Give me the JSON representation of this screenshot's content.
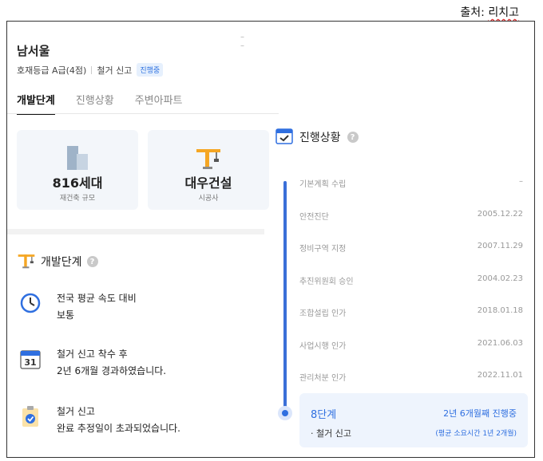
{
  "source": {
    "label": "출처:",
    "name": "리치고"
  },
  "complex": {
    "name": "남서울",
    "grade": "호재등급 A급(4점)",
    "status": "철거 신고",
    "status_badge": "진행중"
  },
  "tabs": [
    {
      "label": "개발단계",
      "active": true
    },
    {
      "label": "진행상황",
      "active": false
    },
    {
      "label": "주변아파트",
      "active": false
    }
  ],
  "cards": [
    {
      "value": "816세대",
      "label": "재건축 규모",
      "icon": "building-icon"
    },
    {
      "value": "대우건설",
      "label": "시공사",
      "icon": "crane-icon"
    }
  ],
  "dev_section": {
    "title": "개발단계",
    "help": "?",
    "items": [
      {
        "icon": "clock-icon",
        "line1": "전국 평균 속도 대비",
        "line2": "보통"
      },
      {
        "icon": "calendar-icon",
        "calendar_day": "31",
        "line1": "철거 신고 착수 후",
        "line2": "2년 6개월 경과하였습니다."
      },
      {
        "icon": "clipboard-check-icon",
        "line1": "철거 신고",
        "line2": "완료 추정일이 초과되었습니다."
      }
    ]
  },
  "progress_section": {
    "title": "진행상황",
    "help": "?",
    "steps": [
      {
        "name": "기본계획 수립",
        "date": "–"
      },
      {
        "name": "안전진단",
        "date": "2005.12.22"
      },
      {
        "name": "정비구역 지정",
        "date": "2007.11.29"
      },
      {
        "name": "추진위원회 승인",
        "date": "2004.02.23"
      },
      {
        "name": "조합설립 인가",
        "date": "2018.01.18"
      },
      {
        "name": "사업시행 인가",
        "date": "2021.06.03"
      },
      {
        "name": "관리처분 인가",
        "date": "2022.11.01"
      }
    ],
    "current": {
      "stage": "8단계",
      "progress": "2년 6개월째 진행중",
      "sub": "· 철거 신고",
      "avg": "(평균 소요시간 1년 2개월)"
    }
  },
  "colors": {
    "accent": "#2f6fe0",
    "card_bg": "#f3f6fa",
    "crane": "#f5a623"
  }
}
